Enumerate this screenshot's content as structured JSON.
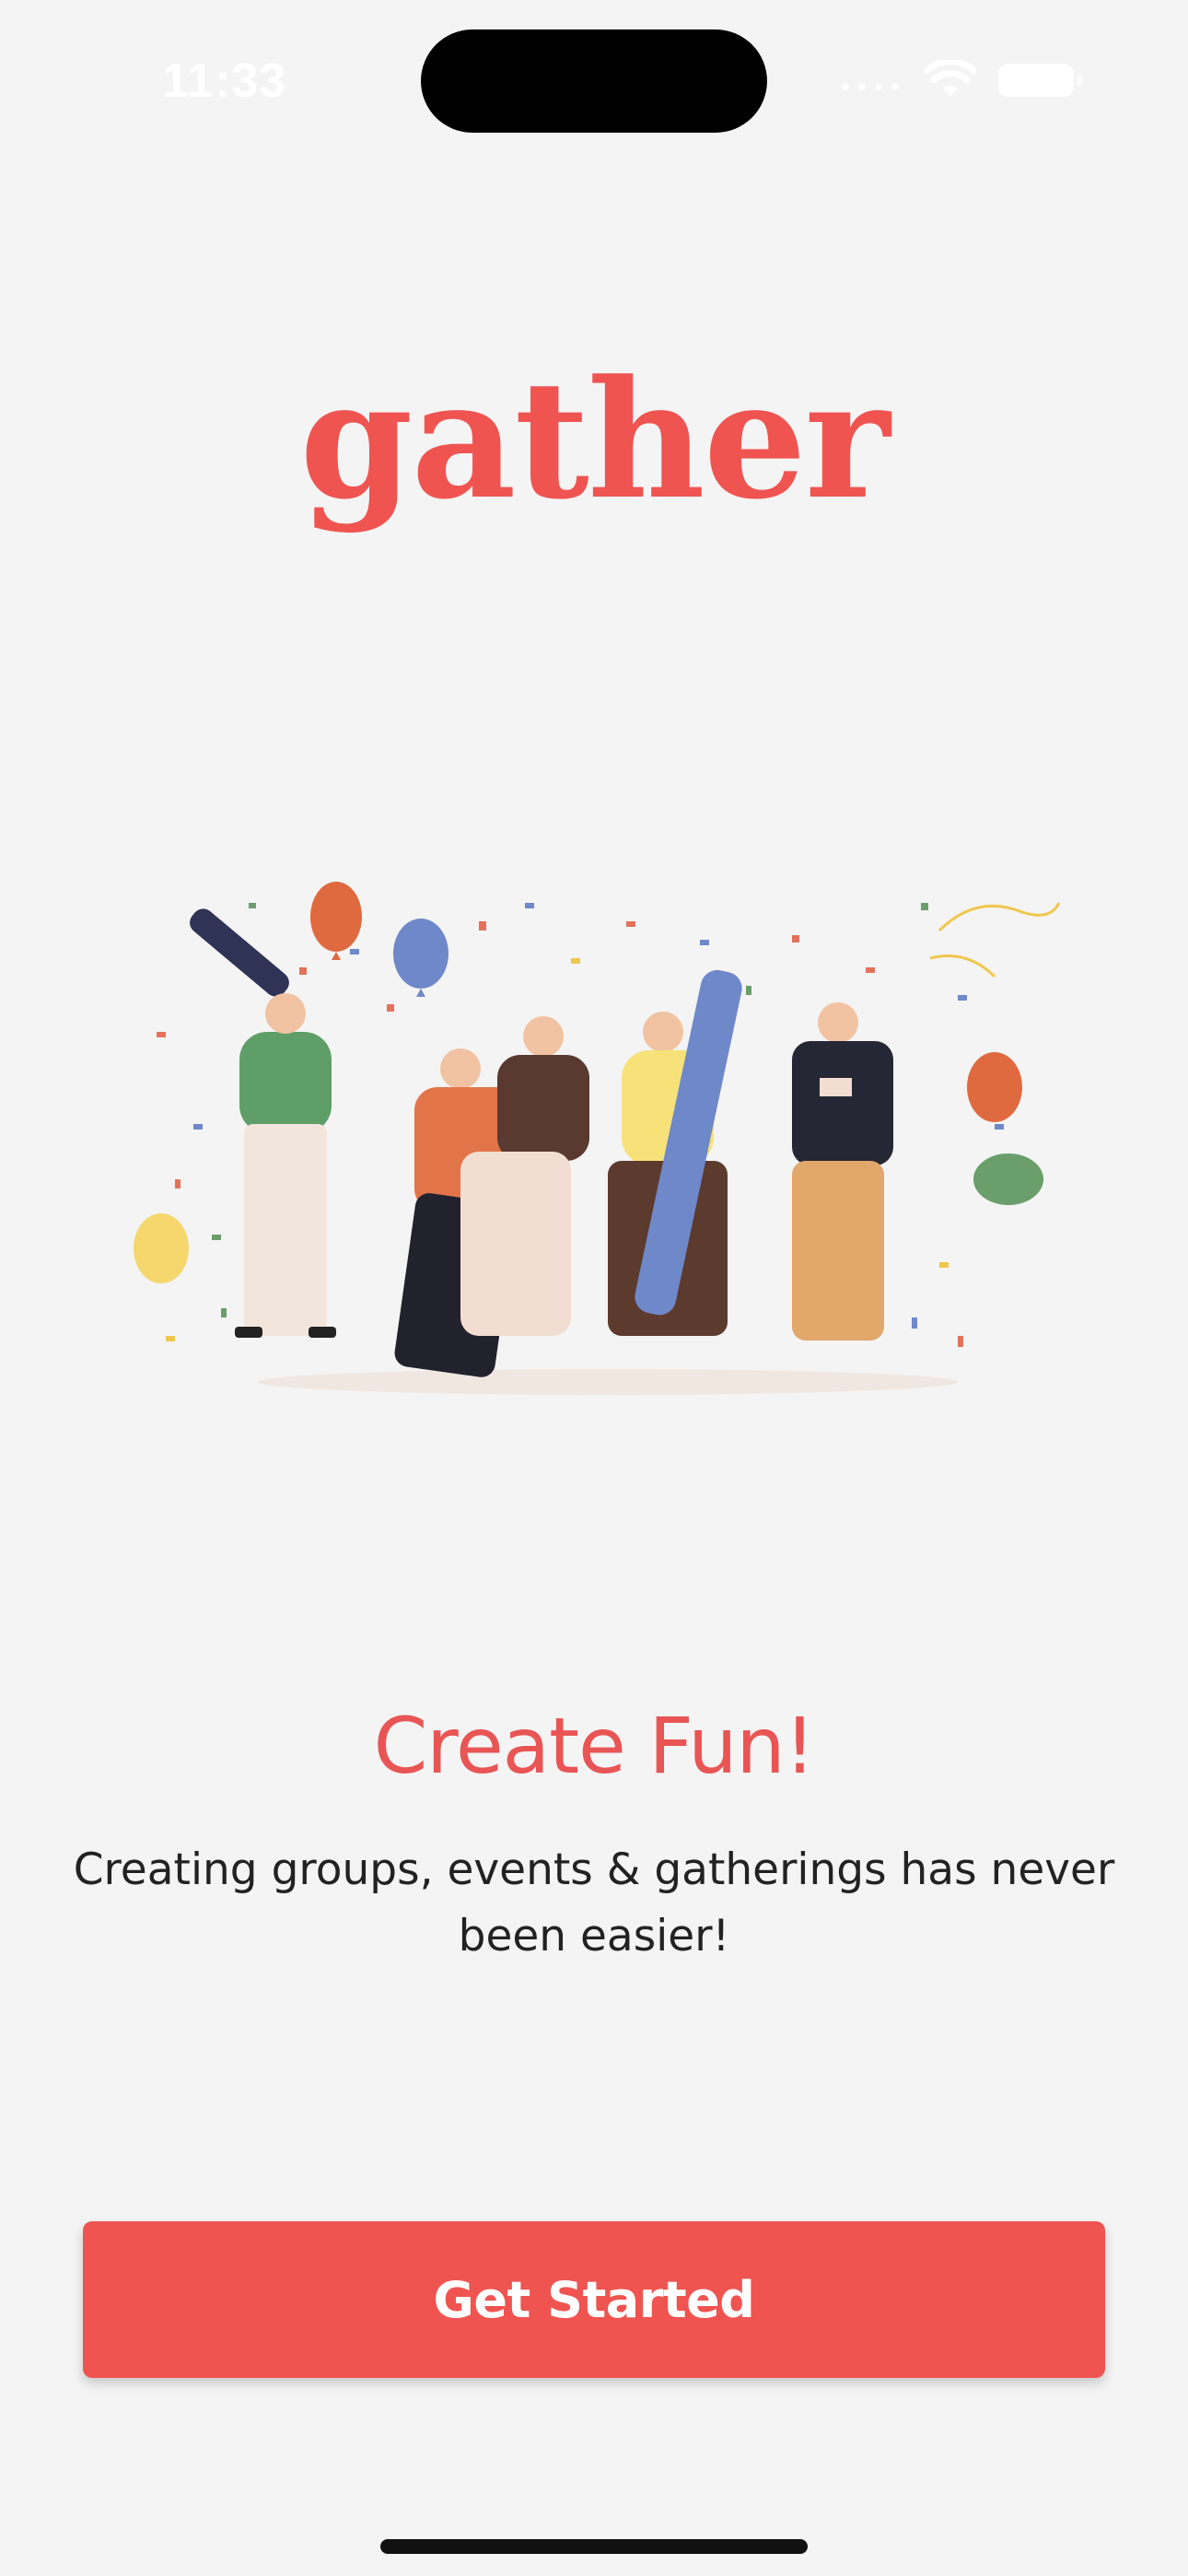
{
  "status_bar": {
    "time": "11:33",
    "icons": [
      "signal-icon",
      "wifi-icon",
      "battery-icon"
    ]
  },
  "brand": {
    "logo_text": "gather",
    "primary_color": "#ef5451",
    "headline_color": "#e85554"
  },
  "illustration": {
    "icon": "party-people-illustration"
  },
  "onboarding": {
    "headline": "Create Fun!",
    "subtitle_line1": "Creating groups, events & gatherings has never",
    "subtitle_line2": "been easier!"
  },
  "cta": {
    "label": "Get Started"
  }
}
